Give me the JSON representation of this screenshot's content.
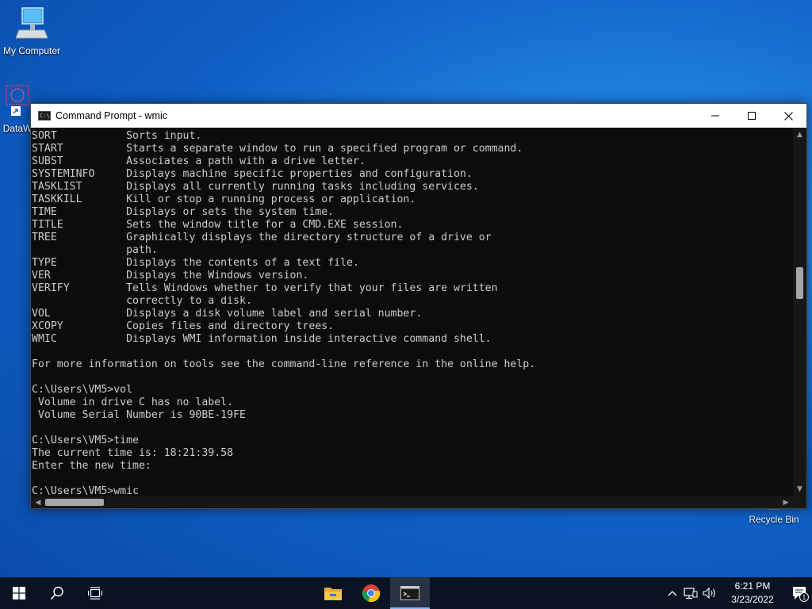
{
  "desktop": {
    "icons": [
      {
        "label": "My Computer"
      },
      {
        "label": "DataW"
      },
      {
        "label": "Recycle Bin"
      }
    ]
  },
  "window": {
    "title": "Command Prompt - wmic",
    "console_lines": [
      "SORT           Sorts input.",
      "START          Starts a separate window to run a specified program or command.",
      "SUBST          Associates a path with a drive letter.",
      "SYSTEMINFO     Displays machine specific properties and configuration.",
      "TASKLIST       Displays all currently running tasks including services.",
      "TASKKILL       Kill or stop a running process or application.",
      "TIME           Displays or sets the system time.",
      "TITLE          Sets the window title for a CMD.EXE session.",
      "TREE           Graphically displays the directory structure of a drive or",
      "               path.",
      "TYPE           Displays the contents of a text file.",
      "VER            Displays the Windows version.",
      "VERIFY         Tells Windows whether to verify that your files are written",
      "               correctly to a disk.",
      "VOL            Displays a disk volume label and serial number.",
      "XCOPY          Copies files and directory trees.",
      "WMIC           Displays WMI information inside interactive command shell.",
      "",
      "For more information on tools see the command-line reference in the online help.",
      "",
      "C:\\Users\\VM5>vol",
      " Volume in drive C has no label.",
      " Volume Serial Number is 90BE-19FE",
      "",
      "C:\\Users\\VM5>time",
      "The current time is: 18:21:39.58",
      "Enter the new time:",
      "",
      "C:\\Users\\VM5>wmic"
    ]
  },
  "taskbar": {
    "clock": {
      "time": "6:21 PM",
      "date": "3/23/2022"
    },
    "notification_count": "1"
  }
}
